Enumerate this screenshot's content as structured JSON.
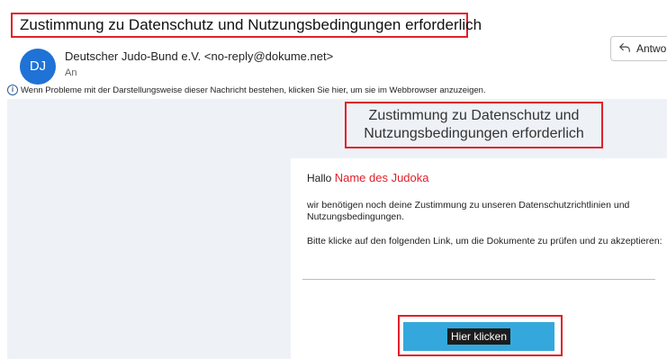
{
  "email": {
    "subject": "Zustimmung zu Datenschutz und Nutzungsbedingungen erforderlich",
    "avatar_initials": "DJ",
    "sender": "Deutscher Judo-Bund e.V. <no-reply@dokume.net>",
    "to_label": "An",
    "reply_label": "Antwo",
    "info_message": "Wenn Probleme mit der Darstellungsweise dieser Nachricht bestehen, klicken Sie hier, um sie im Webbrowser anzuzeigen."
  },
  "body": {
    "heading_line1": "Zustimmung zu Datenschutz und",
    "heading_line2": "Nutzungsbedingungen erforderlich",
    "greeting": "Hallo",
    "recipient_name": "Name des Judoka",
    "paragraph1": "wir benötigen noch deine Zustimmung zu unseren Datenschutzrichtlinien und Nutzungsbedingungen.",
    "paragraph2": "Bitte klicke auf den folgenden Link, um die Dokumente zu prüfen und zu akzeptieren:",
    "button_label": "Hier klicken"
  },
  "colors": {
    "highlight_border": "#e0212b",
    "avatar": "#1f72d6",
    "button": "#34a8dc",
    "canvas": "#eef2f7"
  },
  "icons": {
    "reply": "reply-arrow-icon",
    "info": "info-circle-icon"
  }
}
